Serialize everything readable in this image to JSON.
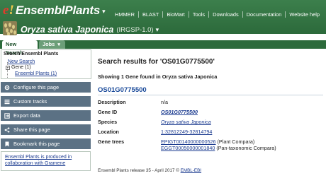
{
  "brand": {
    "e": "e",
    "bang": "!",
    "name": "EnsemblPlants",
    "caret": "▾"
  },
  "topnav": [
    "HMMER",
    "BLAST",
    "BioMart",
    "Tools",
    "Downloads",
    "Documentation",
    "Website help"
  ],
  "species": {
    "name": "Oryza sativa Japonica",
    "assembly": "(IRGSP-1.0)",
    "caret": "▾"
  },
  "tabs": {
    "active": "New Search",
    "jobs": "Jobs",
    "jobs_caret": "▾"
  },
  "sidebar": {
    "header": "Search Ensembl Plants",
    "link_new": "New Search",
    "gene_node": "Gene (1)",
    "gene_node_minus": "−",
    "link_ensembl": "Ensembl Plants (1)",
    "buttons": {
      "configure": "Configure this page",
      "custom": "Custom tracks",
      "export": "Export data",
      "share": "Share this page",
      "bookmark": "Bookmark this page"
    },
    "info": "Ensembl Plants is produced in collaboration with Gramene"
  },
  "main": {
    "title": "Search results for 'OS01G0775500'",
    "subtitle": "Showing 1 Gene found in Oryza sativa Japonica",
    "result_id": "OS01G0775500",
    "rows": {
      "description": {
        "label": "Description",
        "value": "n/a"
      },
      "gene_id": {
        "label": "Gene ID",
        "value": "OS01G0775500"
      },
      "species": {
        "label": "Species",
        "value": "Oryza sativa Japonica"
      },
      "location": {
        "label": "Location",
        "value": "1:32812249-32814794"
      },
      "gene_trees": {
        "label": "Gene trees",
        "tree1_link": "EPIGT00140000000526",
        "tree1_note": "(Plant Compara)",
        "tree2_link": "EGGT00050000001840",
        "tree2_note": "(Pan-taxonomic Compara)"
      }
    },
    "footer": "Ensembl Plants release 35 - April 2017 © EMBL-EBI",
    "footer_link": "EMBL-EBI"
  },
  "colors": {
    "header_green": "#2c6a3b",
    "sidebar_button": "#5b7184",
    "link": "#1a3a8f",
    "brand_e": "#e23b2c"
  }
}
